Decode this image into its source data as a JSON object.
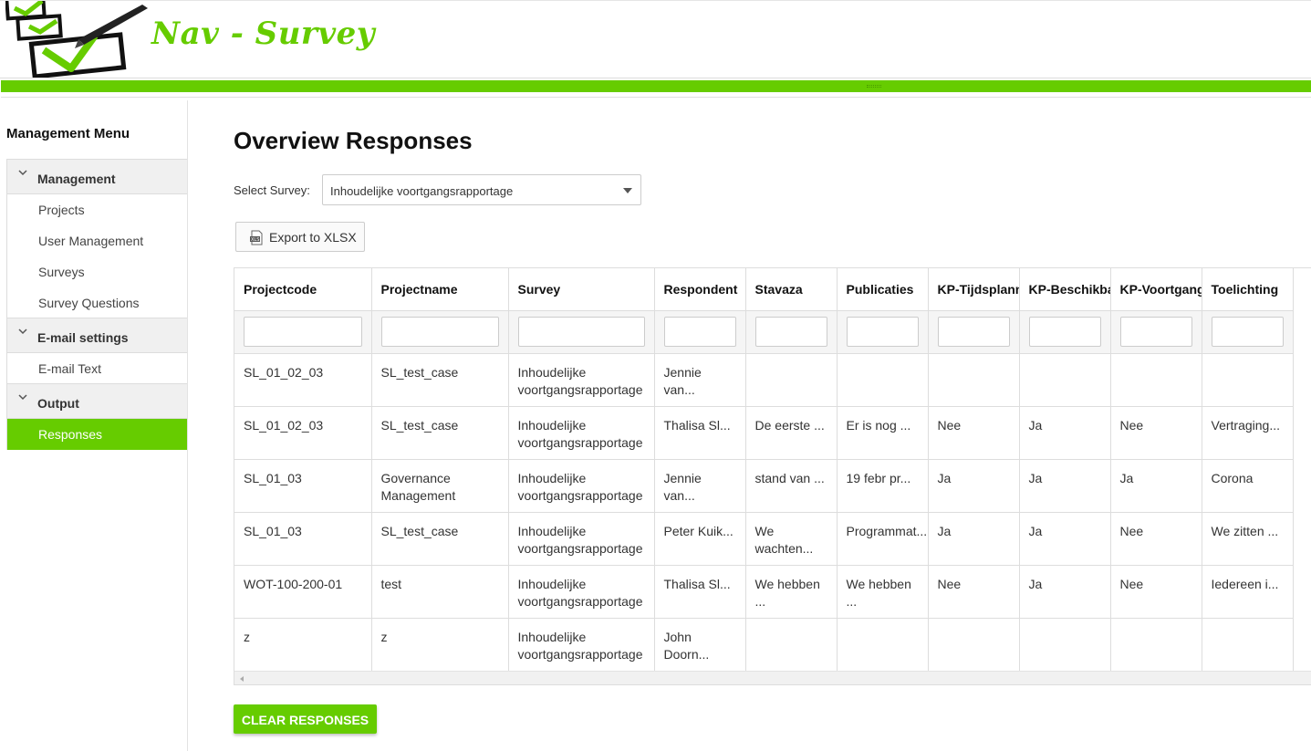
{
  "app": {
    "logo_text": "Nav - Survey",
    "brand_color": "#66cc00"
  },
  "sidebar": {
    "title": "Management Menu",
    "groups": [
      {
        "label": "Management",
        "items": [
          "Projects",
          "User Management",
          "Surveys",
          "Survey Questions"
        ]
      },
      {
        "label": "E-mail settings",
        "items": [
          "E-mail Text"
        ]
      },
      {
        "label": "Output",
        "items": [
          "Responses"
        ]
      }
    ],
    "active_item": "Responses"
  },
  "main": {
    "title": "Overview Responses",
    "select_label": "Select Survey:",
    "select_value": "Inhoudelijke voortgangsrapportage",
    "export_label": "Export to XLSX",
    "clear_label": "CLEAR RESPONSES"
  },
  "table": {
    "columns": [
      "Projectcode",
      "Projectname",
      "Survey",
      "Respondent",
      "Stavaza",
      "Publicaties",
      "KP-Tijdsplanning",
      "KP-Beschikbaarheid",
      "KP-Voortgang",
      "Toelichting"
    ],
    "rows": [
      [
        "SL_01_02_03",
        "SL_test_case",
        "Inhoudelijke voortgangsrapportage",
        "Jennie van...",
        "",
        "",
        "",
        "",
        "",
        ""
      ],
      [
        "SL_01_02_03",
        "SL_test_case",
        "Inhoudelijke voortgangsrapportage",
        "Thalisa Sl...",
        "De eerste ...",
        "Er is nog ...",
        "Nee",
        "Ja",
        "Nee",
        "Vertraging..."
      ],
      [
        "SL_01_03",
        "Governance Management",
        "Inhoudelijke voortgangsrapportage",
        "Jennie van...",
        "stand van ...",
        "19 febr pr...",
        "Ja",
        "Ja",
        "Ja",
        "Corona"
      ],
      [
        "SL_01_03",
        "SL_test_case",
        "Inhoudelijke voortgangsrapportage",
        "Peter Kuik...",
        "We wachten...",
        "Programmat...",
        "Ja",
        "Ja",
        "Nee",
        "We zitten ..."
      ],
      [
        "WOT-100-200-01",
        "test",
        "Inhoudelijke voortgangsrapportage",
        "Thalisa Sl...",
        "We hebben ...",
        "We hebben ...",
        "Nee",
        "Ja",
        "Nee",
        "Iedereen i..."
      ],
      [
        "z",
        "z",
        "Inhoudelijke voortgangsrapportage",
        "John Doorn...",
        "",
        "",
        "",
        "",
        "",
        ""
      ]
    ]
  }
}
